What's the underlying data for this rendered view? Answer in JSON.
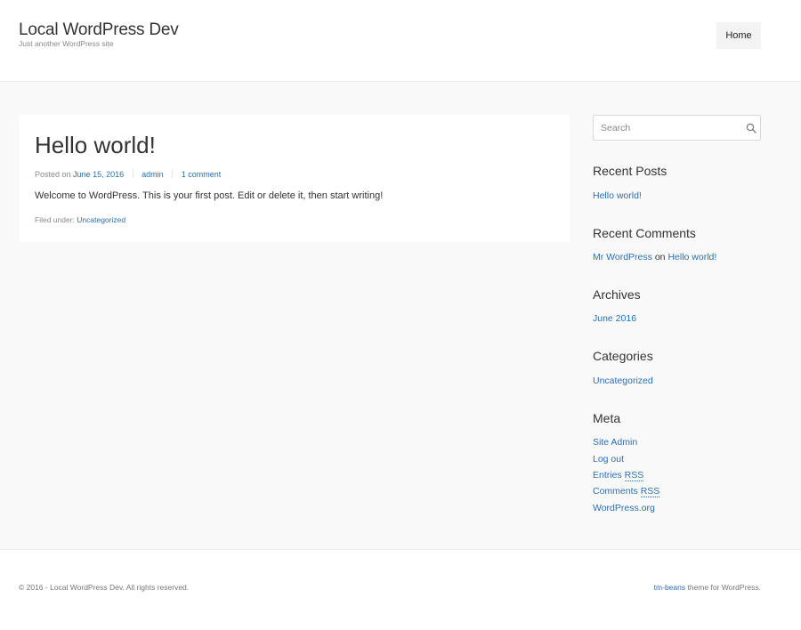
{
  "header": {
    "site_title": "Local WordPress Dev",
    "tagline": "Just another WordPress site",
    "nav": {
      "home": "Home"
    }
  },
  "post": {
    "title": "Hello world!",
    "meta": {
      "posted_on_label": "Posted on",
      "date": "June 15, 2016",
      "author": "admin",
      "comments": "1 comment"
    },
    "content": "Welcome to WordPress. This is your first post. Edit or delete it, then start writing!",
    "footer": {
      "filed_under_label": "Filed under:",
      "category": "Uncategorized"
    }
  },
  "sidebar": {
    "search": {
      "placeholder": "Search",
      "icon": "search-icon"
    },
    "recent_posts": {
      "title": "Recent Posts",
      "items": [
        "Hello world!"
      ]
    },
    "recent_comments": {
      "title": "Recent Comments",
      "author": "Mr WordPress",
      "on": "on",
      "post": "Hello world!"
    },
    "archives": {
      "title": "Archives",
      "items": [
        "June 2016"
      ]
    },
    "categories": {
      "title": "Categories",
      "items": [
        "Uncategorized"
      ]
    },
    "meta": {
      "title": "Meta",
      "site_admin": "Site Admin",
      "log_out": "Log out",
      "entries_prefix": "Entries",
      "entries_abbr": "RSS",
      "comments_prefix": "Comments",
      "comments_abbr": "RSS",
      "wordpress_org": "WordPress.org"
    }
  },
  "footer": {
    "copyright": "© 2016 - Local WordPress Dev. All rights reserved.",
    "theme_link": "tm-beans",
    "theme_suffix": "theme for WordPress."
  },
  "colors": {
    "link": "#2a6fb4",
    "background": "#f9f9f9",
    "nav_bg": "#f3f3f3"
  }
}
